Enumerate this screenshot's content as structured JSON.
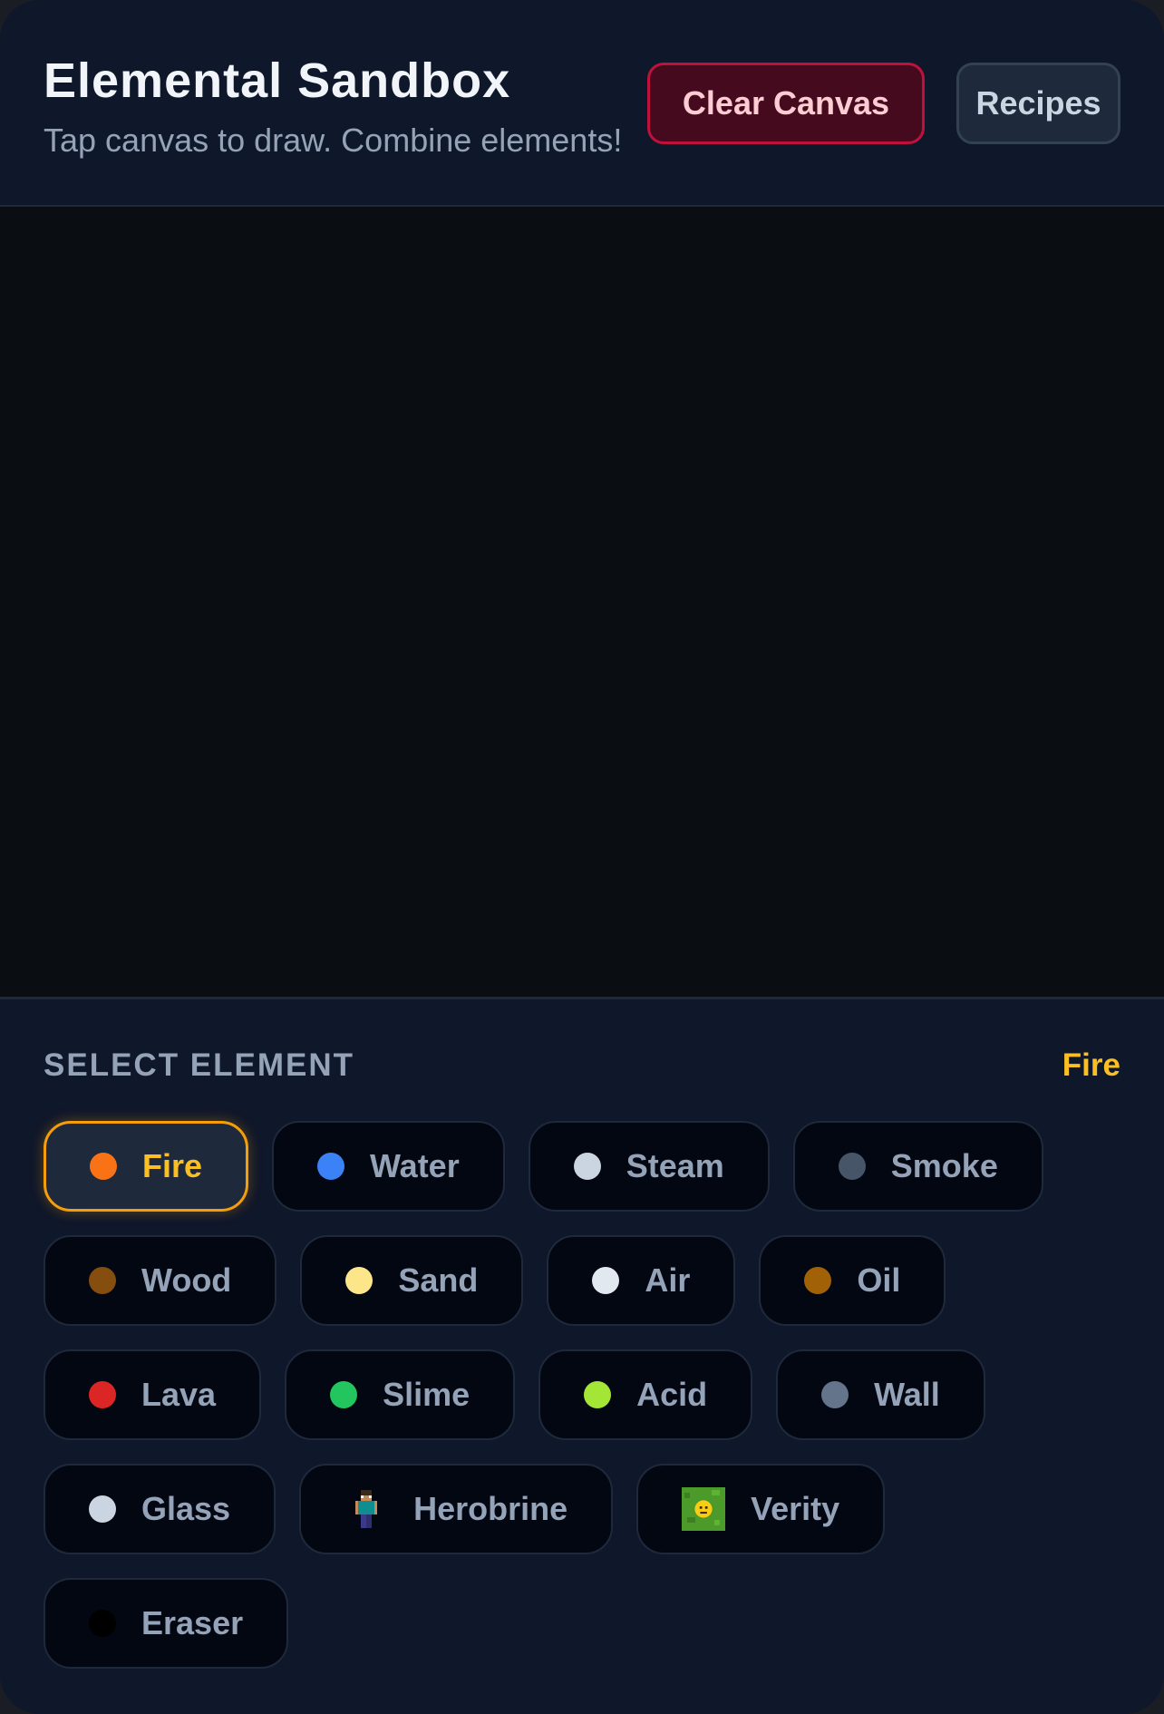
{
  "header": {
    "title": "Elemental Sandbox",
    "subtitle": "Tap canvas to draw. Combine elements!",
    "clear_label": "Clear Canvas",
    "recipes_label": "Recipes"
  },
  "panel": {
    "label": "SELECT ELEMENT",
    "current": "Fire"
  },
  "elements": [
    {
      "label": "Fire",
      "color": "#f97316",
      "selected": true
    },
    {
      "label": "Water",
      "color": "#3b82f6"
    },
    {
      "label": "Steam",
      "color": "#cbd5e1"
    },
    {
      "label": "Smoke",
      "color": "#475569"
    },
    {
      "label": "Wood",
      "color": "#854d0e"
    },
    {
      "label": "Sand",
      "color": "#fde68a"
    },
    {
      "label": "Air",
      "color": "#e2e8f0"
    },
    {
      "label": "Oil",
      "color": "#a16207"
    },
    {
      "label": "Lava",
      "color": "#dc2626"
    },
    {
      "label": "Slime",
      "color": "#22c55e"
    },
    {
      "label": "Acid",
      "color": "#a3e635"
    },
    {
      "label": "Wall",
      "color": "#64748b"
    },
    {
      "label": "Glass",
      "color": "#cbd5e1"
    },
    {
      "label": "Herobrine",
      "icon": "herobrine-figure-icon"
    },
    {
      "label": "Verity",
      "icon": "grass-block-smiley-icon"
    },
    {
      "label": "Eraser",
      "color": "#000000"
    }
  ]
}
